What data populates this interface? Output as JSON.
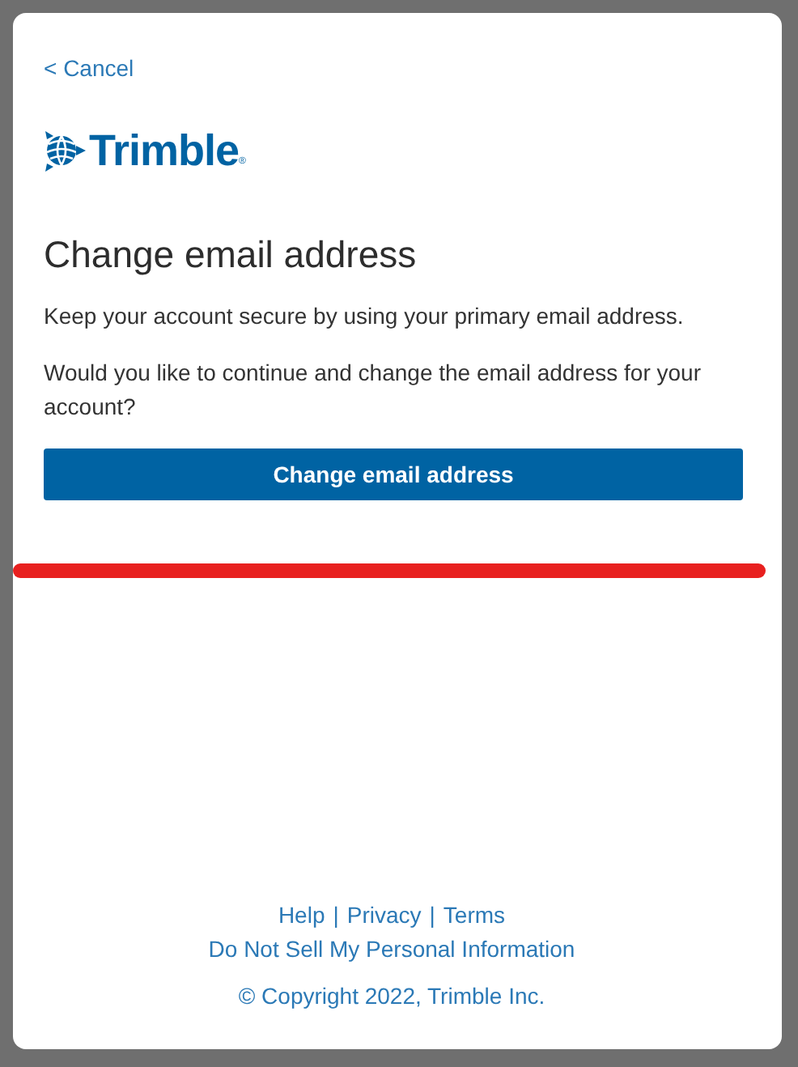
{
  "dialog": {
    "cancel_link": "< Cancel",
    "logo": {
      "wordmark": "Trimble",
      "registered": "®"
    },
    "title": "Change email address",
    "paragraphs": [
      "Keep your account secure by using your primary email address.",
      "Would you like to continue and change the email address for your account?"
    ],
    "primary_button": "Change email address",
    "footer": {
      "links_row": [
        "Help",
        "Privacy",
        "Terms"
      ],
      "separator": "|",
      "privacy_link": "Do Not Sell My Personal Information",
      "copyright": "© Copyright 2022, Trimble Inc."
    }
  }
}
